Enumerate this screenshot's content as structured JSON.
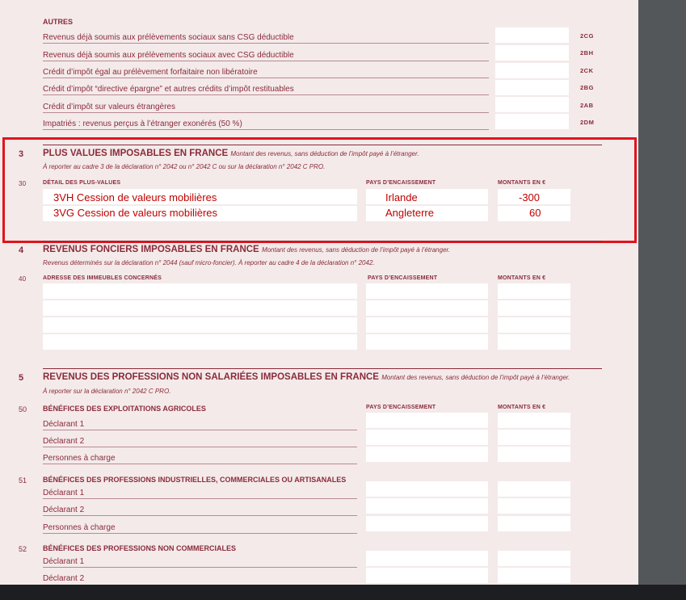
{
  "autres": {
    "title": "AUTRES",
    "rows": [
      {
        "label": "Revenus déjà soumis aux prélèvements sociaux sans CSG déductible",
        "code": "2CG"
      },
      {
        "label": "Revenus déjà soumis aux prélèvements sociaux avec CSG déductible",
        "code": "2BH"
      },
      {
        "label": "Crédit d’impôt égal au prélèvement forfaitaire non libératoire",
        "code": "2CK"
      },
      {
        "label": "Crédit d’impôt “directive épargne” et autres crédits d’impôt restituables",
        "code": "2BG"
      },
      {
        "label": "Crédit d’impôt sur valeurs étrangères",
        "code": "2AB"
      },
      {
        "label": "Impatriés : revenus perçus à l’étranger exonérés (50 %)",
        "code": "2DM"
      }
    ]
  },
  "section3": {
    "number": "3",
    "title": "PLUS VALUES IMPOSABLES EN FRANCE",
    "subtitle": "Montant des revenus, sans déduction de l’impôt payé à l’étranger.",
    "note": "À reporter au cadre 3 de la déclaration n° 2042 ou n° 2042 C ou sur la déclaration n° 2042 C PRO.",
    "line_number": "30",
    "col_detail": "DÉTAIL DES PLUS-VALUES",
    "col_pays": "PAYS D’ENCAISSEMENT",
    "col_montant": "MONTANTS EN €",
    "entries": [
      {
        "detail": "3VH Cession de valeurs mobilières",
        "pays": "Irlande",
        "montant": "-300"
      },
      {
        "detail": "3VG Cession de valeurs mobilières",
        "pays": "Angleterre",
        "montant": "60"
      }
    ]
  },
  "section4": {
    "number": "4",
    "title": "REVENUS FONCIERS IMPOSABLES EN FRANCE",
    "subtitle": "Montant des revenus, sans déduction de l’impôt payé à l’étranger.",
    "note": "Revenus déterminés sur la déclaration n° 2044 (sauf micro-foncier). À reporter au cadre 4 de la déclaration n° 2042.",
    "line_number": "40",
    "col_adresse": "ADRESSE DES IMMEUBLES CONCERNÉS",
    "col_pays": "PAYS D’ENCAISSEMENT",
    "col_montant": "MONTANTS EN €"
  },
  "section5": {
    "number": "5",
    "title": "REVENUS DES PROFESSIONS NON SALARIÉES IMPOSABLES EN FRANCE",
    "subtitle": "Montant des revenus, sans déduction de l’impôt payé à l’étranger.",
    "note": "À reporter sur la déclaration n° 2042 C PRO.",
    "col_pays": "PAYS D’ENCAISSEMENT",
    "col_montant": "MONTANTS EN €",
    "groups": [
      {
        "number": "50",
        "title": "BÉNÉFICES DES EXPLOITATIONS AGRICOLES",
        "rows": [
          "Déclarant 1",
          "Déclarant 2",
          "Personnes à charge"
        ]
      },
      {
        "number": "51",
        "title": "BÉNÉFICES DES PROFESSIONS INDUSTRIELLES, COMMERCIALES OU ARTISANALES",
        "rows": [
          "Déclarant 1",
          "Déclarant 2",
          "Personnes à charge"
        ]
      },
      {
        "number": "52",
        "title": "BÉNÉFICES DES PROFESSIONS NON COMMERCIALES",
        "rows": [
          "Déclarant 1",
          "Déclarant 2"
        ]
      }
    ]
  }
}
